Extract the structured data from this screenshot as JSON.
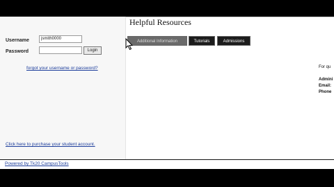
{
  "page": {
    "heading": "Helpful Resources"
  },
  "login": {
    "username_label": "Username",
    "username_value": "jsmith0000",
    "password_label": "Password",
    "password_value": "",
    "login_button": "Login",
    "forgot_link": "forgot your username or password?"
  },
  "sidebar": {
    "purchase_link": "Click here to purchase your student account."
  },
  "tabs": [
    {
      "label": "Additional Information",
      "active": true
    },
    {
      "label": "Tutorials",
      "active": false
    },
    {
      "label": "Admissions",
      "active": false
    }
  ],
  "right_panel": {
    "for_questions": "For qu",
    "admin": "Admini",
    "email": "Email:",
    "phone": "Phone"
  },
  "footer": {
    "powered_by": "Powered by Tk20 CampusTools"
  },
  "icons": {
    "cursor": "mouse-pointer-icon"
  }
}
